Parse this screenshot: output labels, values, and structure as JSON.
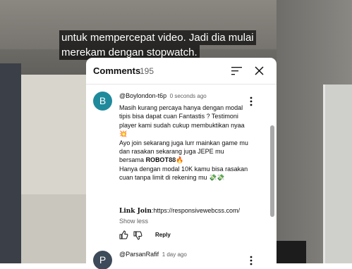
{
  "subtitles": {
    "line1": "untuk mempercepat video. Jadi dia mulai",
    "line2": "merekam dengan stopwatch."
  },
  "comments_panel": {
    "title": "Comments",
    "count": "195",
    "sort_icon": "sort-icon",
    "close_icon": "close-icon"
  },
  "comments": [
    {
      "avatar_letter": "B",
      "avatar_color": "#1f8a9b",
      "author": "@Boylondon-t6p",
      "time": "0 seconds ago",
      "lines": [
        "Masih kurang percaya hanya dengan modal tipis bisa dapat cuan Fantastis ? Testimoni player kami sudah cukup membuktikan nyaa 💥",
        "Ayo join sekarang juga lurr mainkan game mu dan rasakan sekarang juga JEPE mu bersama 𝐑𝐎𝐁𝐎𝐓𝟖𝟖🔥",
        "Hanya dengan modal 10K kamu bisa rasakan cuan tanpa limit di rekening mu 💸💸"
      ],
      "link_label": "𝐋𝐢𝐧𝐤 𝐉𝐨𝐢𝐧",
      "link_url": ":https://responsivewebcss.com/",
      "show_less": "Show less",
      "reply": "Reply"
    },
    {
      "avatar_letter": "P",
      "avatar_color": "#3c4a59",
      "author": "@ParsanRafif",
      "time": "1 day ago"
    }
  ]
}
